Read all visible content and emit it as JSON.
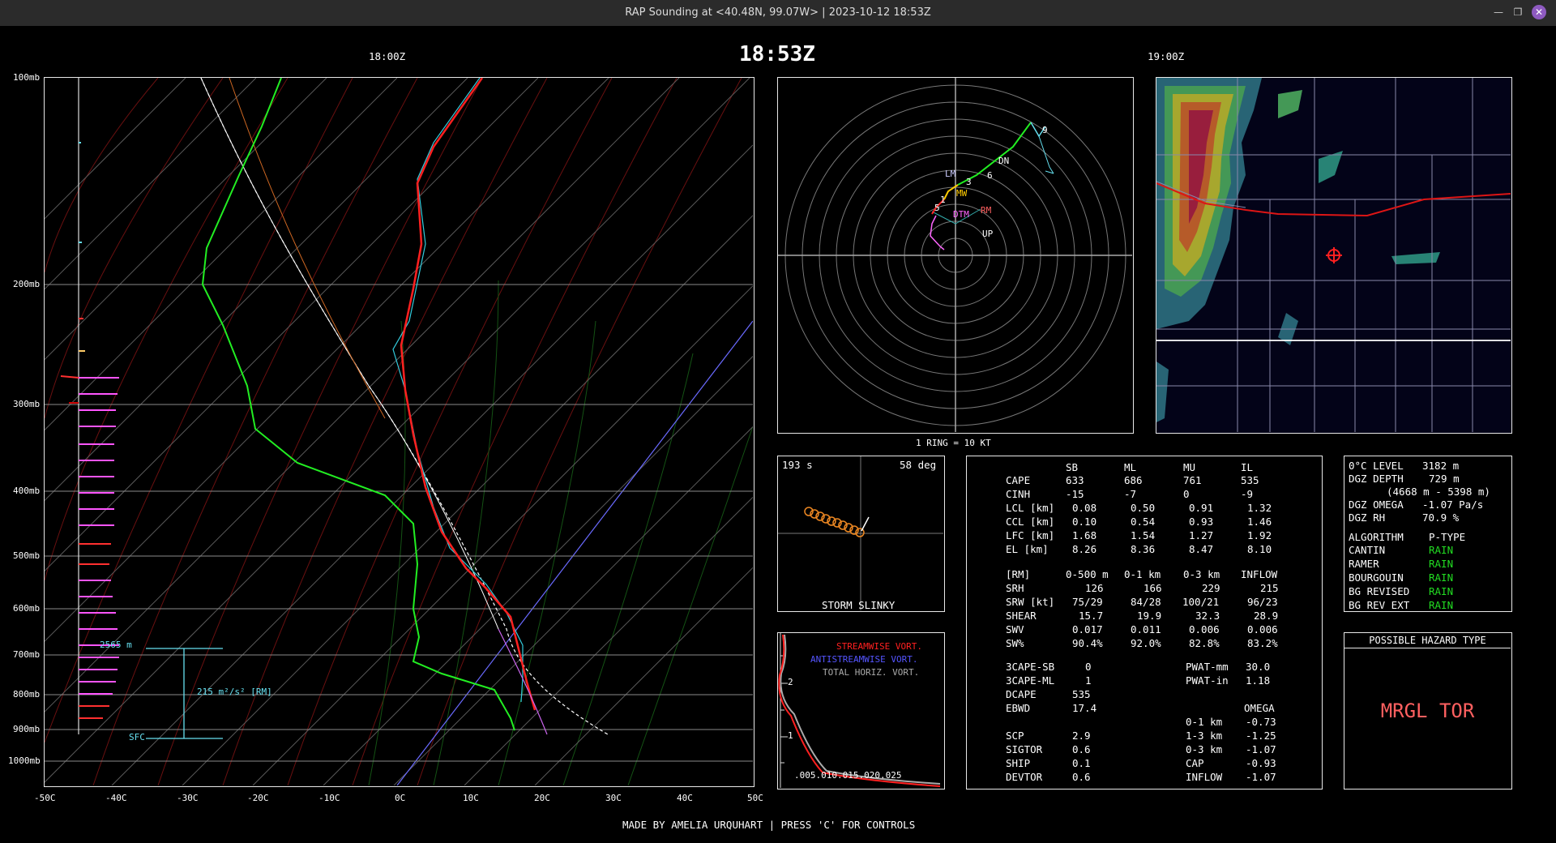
{
  "window": {
    "title": "RAP Sounding at <40.48N, 99.07W> | 2023-10-12 18:53Z"
  },
  "header": {
    "left_time": "18:00Z",
    "center_time": "18:53Z",
    "right_time": "19:00Z"
  },
  "skewt": {
    "pressure_labels": [
      "100mb",
      "200mb",
      "300mb",
      "400mb",
      "500mb",
      "600mb",
      "700mb",
      "800mb",
      "900mb",
      "1000mb"
    ],
    "temp_labels": [
      "-50C",
      "-40C",
      "-30C",
      "-20C",
      "-10C",
      "0C",
      "10C",
      "20C",
      "30C",
      "40C",
      "50C"
    ],
    "srh_top": "2565 m",
    "srh_value": "215 m²/s² [RM]",
    "srh_sfc": "SFC"
  },
  "hodograph": {
    "ring_label": "1 RING = 10 KT",
    "markers": {
      "lm": "LM",
      "dn": "DN",
      "mw": "MW",
      "rm": "RM",
      "dtm": "DTM",
      "up": "UP",
      "h1": "1",
      "h3": "3",
      "h5": "5",
      "h6": "6",
      "h9": "9"
    }
  },
  "slinky": {
    "time": "193 s",
    "angle": "58 deg",
    "title": "STORM SLINKY"
  },
  "vorticity": {
    "streamwise": "STREAMWISE VORT.",
    "antistreamwise": "ANTISTREAMWISE VORT.",
    "total": "TOTAL HORIZ. VORT.",
    "xticks": ".005.010.015.020.025",
    "y2": "2",
    "y1": "1"
  },
  "params": {
    "header": [
      "SB",
      "ML",
      "MU",
      "IL"
    ],
    "rows1": [
      [
        "CAPE",
        "633",
        "686",
        "761",
        "535"
      ],
      [
        "CINH",
        "-15",
        "-7",
        "0",
        "-9"
      ],
      [
        "LCL [km]",
        "0.08",
        "0.50",
        "0.91",
        "1.32"
      ],
      [
        "CCL [km]",
        "0.10",
        "0.54",
        "0.93",
        "1.46"
      ],
      [
        "LFC [km]",
        "1.68",
        "1.54",
        "1.27",
        "1.92"
      ],
      [
        "EL [km]",
        "8.26",
        "8.36",
        "8.47",
        "8.10"
      ]
    ],
    "kin_header": [
      "[RM]",
      "0-500 m",
      "0-1 km",
      "0-3 km",
      "INFLOW"
    ],
    "rows2": [
      [
        "SRH",
        "126",
        "166",
        "229",
        "215"
      ],
      [
        "SRW [kt]",
        "75/29",
        "84/28",
        "100/21",
        "96/23"
      ],
      [
        "SHEAR",
        "15.7",
        "19.9",
        "32.3",
        "28.9"
      ],
      [
        "SWV",
        "0.017",
        "0.011",
        "0.006",
        "0.006"
      ],
      [
        "SW%",
        "90.4%",
        "92.0%",
        "82.8%",
        "83.2%"
      ]
    ],
    "misc_left": [
      [
        "3CAPE-SB",
        "0"
      ],
      [
        "3CAPE-ML",
        "1"
      ],
      [
        "DCAPE",
        "535"
      ],
      [
        "EBWD",
        "17.4"
      ]
    ],
    "misc_right": [
      [
        "PWAT-mm",
        "30.0"
      ],
      [
        "PWAT-in",
        "1.18"
      ]
    ],
    "omega_title": "OMEGA",
    "omega_rows": [
      [
        "0-1 km",
        "-0.73"
      ],
      [
        "1-3 km",
        "-1.25"
      ],
      [
        "0-3 km",
        "-1.07"
      ],
      [
        "CAP",
        "-0.93"
      ],
      [
        "INFLOW",
        "-1.07"
      ]
    ],
    "composite": [
      [
        "SCP",
        "2.9"
      ],
      [
        "SIGTOR",
        "0.6"
      ],
      [
        "SHIP",
        "0.1"
      ],
      [
        "DEVTOR",
        "0.6"
      ]
    ]
  },
  "dgz": {
    "freeze_label": "0°C LEVEL",
    "freeze_val": "3182 m",
    "depth_label": "DGZ DEPTH",
    "depth_val": "729 m",
    "range": "(4668 m - 5398 m)",
    "omega_label": "DGZ OMEGA",
    "omega_val": "-1.07 Pa/s",
    "rh_label": "DGZ RH",
    "rh_val": "70.9 %",
    "alg_header": "ALGORITHM",
    "ptype_header": "P-TYPE",
    "algos": [
      [
        "CANTIN",
        "RAIN"
      ],
      [
        "RAMER",
        "RAIN"
      ],
      [
        "BOURGOUIN",
        "RAIN"
      ],
      [
        "BG REVISED",
        "RAIN"
      ],
      [
        "BG REV EXT",
        "RAIN"
      ]
    ]
  },
  "hazard": {
    "title": "POSSIBLE HAZARD TYPE",
    "value": "MRGL TOR"
  },
  "footer": "MADE BY AMELIA URQUHART | PRESS 'C' FOR CONTROLS",
  "colors": {
    "temp": "#ff2020",
    "dew": "#22ee22",
    "wetbulb": "#33ccdd",
    "parcel": "#ffffff",
    "accent_cyan": "#66e0f0",
    "rain": "#22dd22",
    "hazard": "#ff6060",
    "stream": "#ff2020",
    "antistream": "#5555ff"
  }
}
